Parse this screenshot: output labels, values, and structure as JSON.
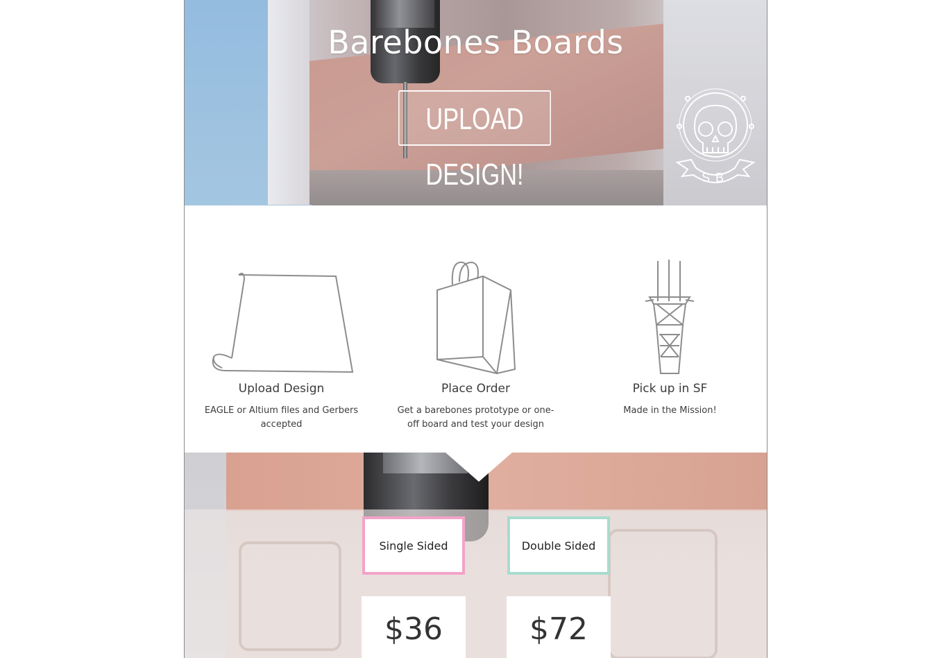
{
  "hero": {
    "title": "Barebones Boards",
    "upload_button": "UPLOAD DESIGN!",
    "logo_letters": "SB"
  },
  "features": [
    {
      "title": "Upload Design",
      "description": "EAGLE or Altium files and Gerbers accepted",
      "icon": "paper-scroll-icon"
    },
    {
      "title": "Place Order",
      "description": "Get a barebones prototype or one-off board and test your design",
      "icon": "shopping-bag-icon"
    },
    {
      "title": "Pick up in SF",
      "description": "Made in the Mission!",
      "icon": "sutro-tower-icon"
    }
  ],
  "pricing": {
    "single": {
      "label": "Single Sided",
      "price": "$36",
      "accent": "#f4a3c8"
    },
    "double": {
      "label": "Double Sided",
      "price": "$72",
      "accent": "#a8dccd"
    }
  }
}
